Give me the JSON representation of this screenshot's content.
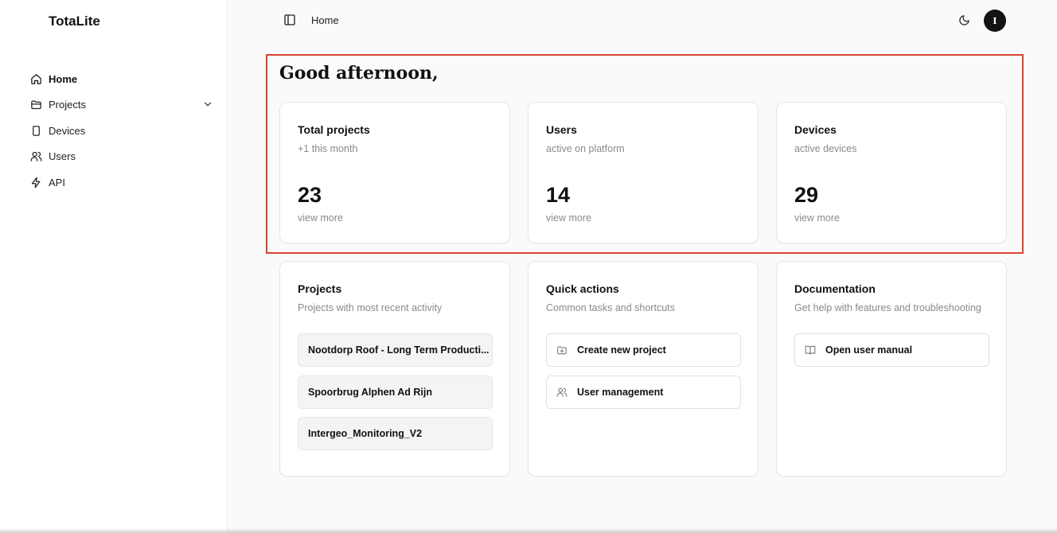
{
  "app": {
    "brand": "TotaLite"
  },
  "sidebar": {
    "items": [
      {
        "label": "Home",
        "icon": "home-icon",
        "active": true
      },
      {
        "label": "Projects",
        "icon": "folder-icon",
        "expandable": true
      },
      {
        "label": "Devices",
        "icon": "device-icon"
      },
      {
        "label": "Users",
        "icon": "users-icon"
      },
      {
        "label": "API",
        "icon": "bolt-icon"
      }
    ]
  },
  "header": {
    "breadcrumb": "Home",
    "avatar_initial": "I"
  },
  "main": {
    "greeting": "Good afternoon,",
    "stats": [
      {
        "title": "Total projects",
        "subtitle": "+1 this month",
        "value": "23",
        "link": "view more"
      },
      {
        "title": "Users",
        "subtitle": "active on platform",
        "value": "14",
        "link": "view more"
      },
      {
        "title": "Devices",
        "subtitle": "active devices",
        "value": "29",
        "link": "view more"
      }
    ],
    "projects": {
      "title": "Projects",
      "subtitle": "Projects with most recent activity",
      "items": [
        "Nootdorp Roof - Long Term Producti...",
        "Spoorbrug Alphen Ad Rijn",
        "Intergeo_Monitoring_V2"
      ]
    },
    "quick_actions": {
      "title": "Quick actions",
      "subtitle": "Common tasks and shortcuts",
      "items": [
        {
          "label": "Create new project",
          "icon": "folder-plus-icon"
        },
        {
          "label": "User management",
          "icon": "users-icon"
        }
      ]
    },
    "documentation": {
      "title": "Documentation",
      "subtitle": "Get help with features and troubleshooting",
      "items": [
        {
          "label": "Open user manual",
          "icon": "book-open-icon"
        }
      ]
    }
  },
  "colors": {
    "highlight": "#d9442f",
    "avatar_bg": "#141414",
    "muted_text": "#8a8a8a"
  }
}
